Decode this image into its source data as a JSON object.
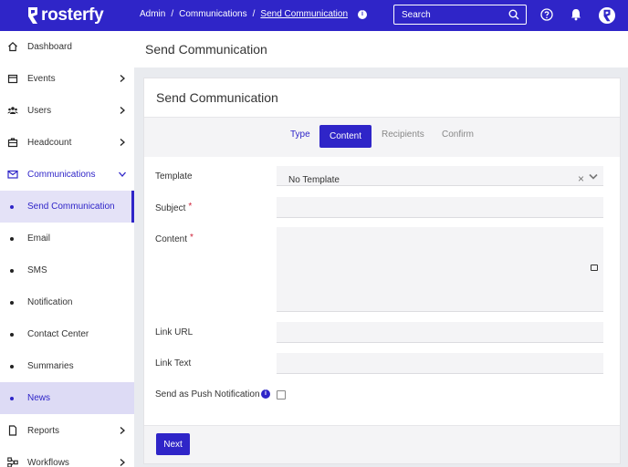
{
  "brand": {
    "name": "rosterfy"
  },
  "breadcrumb": {
    "items": [
      "Admin",
      "Communications",
      "Send Communication"
    ],
    "separator": "/"
  },
  "search": {
    "placeholder": "Search"
  },
  "colors": {
    "primary": "#2f25c8",
    "required": "#d0233a"
  },
  "sidebar": {
    "items": [
      {
        "label": "Dashboard",
        "icon": "home-icon"
      },
      {
        "label": "Events",
        "icon": "calendar-icon"
      },
      {
        "label": "Users",
        "icon": "users-icon"
      },
      {
        "label": "Headcount",
        "icon": "briefcase-icon"
      },
      {
        "label": "Communications",
        "icon": "mail-icon"
      },
      {
        "label": "Reports",
        "icon": "document-icon"
      },
      {
        "label": "Workflows",
        "icon": "workflow-icon"
      }
    ],
    "sub_items": [
      {
        "label": "Send Communication"
      },
      {
        "label": "Email"
      },
      {
        "label": "SMS"
      },
      {
        "label": "Notification"
      },
      {
        "label": "Contact Center"
      },
      {
        "label": "Summaries"
      },
      {
        "label": "News"
      }
    ]
  },
  "page": {
    "title": "Send Communication"
  },
  "card": {
    "title": "Send Communication",
    "steps": [
      "Type",
      "Content",
      "Recipients",
      "Confirm"
    ],
    "active_step": "Content"
  },
  "form": {
    "template": {
      "label": "Template",
      "value": "No Template"
    },
    "subject": {
      "label": "Subject",
      "value": ""
    },
    "content": {
      "label": "Content",
      "value": ""
    },
    "link_url": {
      "label": "Link URL",
      "value": ""
    },
    "link_text": {
      "label": "Link Text",
      "value": ""
    },
    "push": {
      "label": "Send as Push Notification",
      "checked": false
    },
    "required_mark": "*"
  },
  "actions": {
    "next_label": "Next"
  }
}
